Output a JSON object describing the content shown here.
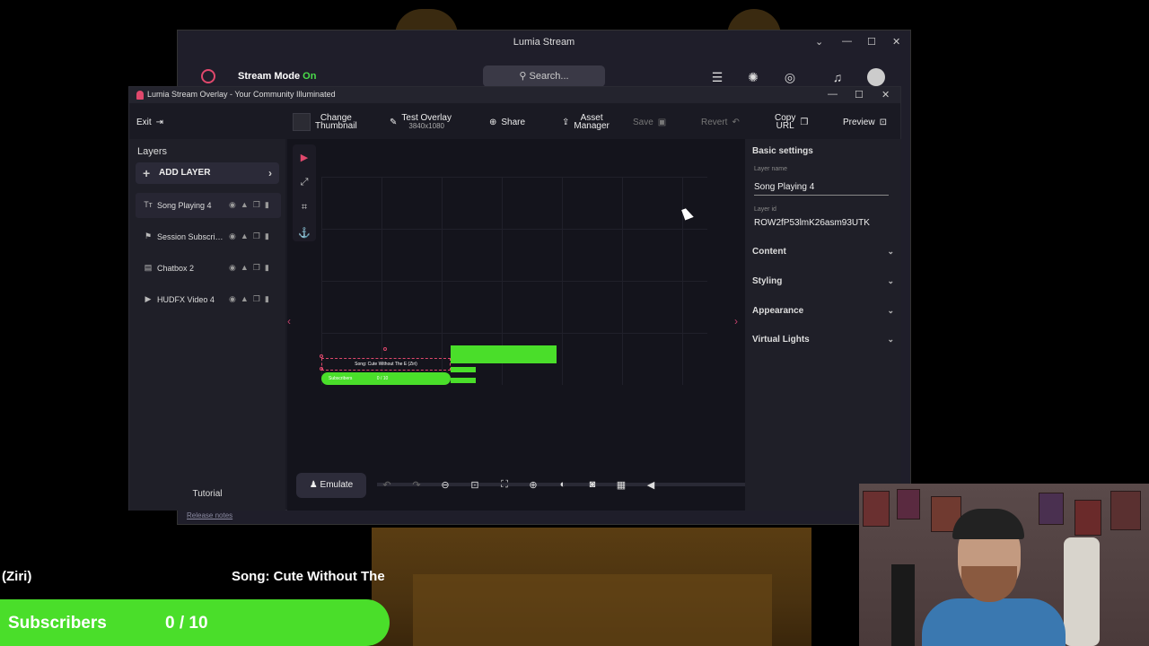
{
  "main_window": {
    "title": "Lumia Stream",
    "stream_mode_label": "Stream Mode",
    "stream_mode_state": "On",
    "search_placeholder": "Search...",
    "release_notes": "Release notes"
  },
  "overlay_window": {
    "title": "Lumia Stream Overlay - Your Community Illuminated",
    "toolbar": {
      "exit": "Exit",
      "change_thumbnail_1": "Change",
      "change_thumbnail_2": "Thumbnail",
      "overlay_name": "Test Overlay",
      "overlay_resolution": "3840x1080",
      "share": "Share",
      "asset_manager_1": "Asset",
      "asset_manager_2": "Manager",
      "save": "Save",
      "revert": "Revert",
      "copy_url_1": "Copy",
      "copy_url_2": "URL",
      "preview": "Preview"
    },
    "layers": {
      "title": "Layers",
      "add_layer": "ADD LAYER",
      "items": [
        {
          "name": "Song Playing 4",
          "icon": "Tт",
          "active": true
        },
        {
          "name": "Session Subscribers 2",
          "icon": "⚑",
          "active": false
        },
        {
          "name": "Chatbox 2",
          "icon": "▤",
          "active": false
        },
        {
          "name": "HUDFX Video 4",
          "icon": "▶",
          "active": false
        }
      ],
      "tutorial": "Tutorial"
    },
    "canvas": {
      "emulate": "Emulate",
      "mini_song": "Song: Cute Without The E (Ziri)",
      "mini_subscribers": "Subscribers",
      "mini_count": "0 / 10"
    },
    "settings": {
      "title": "Basic settings",
      "layer_name_label": "Layer name",
      "layer_name_value": "Song Playing 4",
      "layer_id_label": "Layer id",
      "layer_id_value": "ROW2fP53lmK26asm93UTK",
      "sections": [
        "Content",
        "Styling",
        "Appearance",
        "Virtual Lights"
      ]
    }
  },
  "stream_overlay": {
    "artist": "(Ziri)",
    "song": "Song: Cute Without The",
    "subscribers_label": "Subscribers",
    "subscribers_count": "0 / 10"
  },
  "colors": {
    "accent_pink": "#e0486c",
    "accent_green": "#4ade2a",
    "panel_bg": "#1f1f28"
  }
}
